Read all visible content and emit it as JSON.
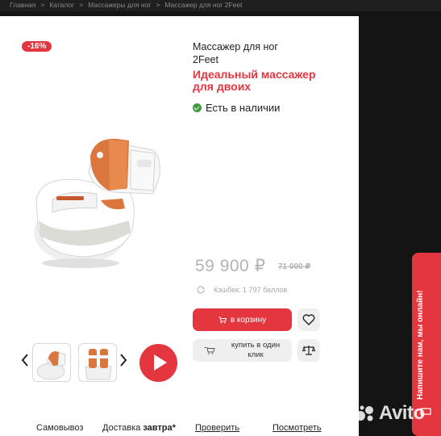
{
  "breadcrumb": [
    "Главная",
    "Каталог",
    "Массажеры для ног",
    "Массажер для ног 2Feet"
  ],
  "breadcrumb_separator": ">",
  "product": {
    "discount": "-16%",
    "title_line1": "Массажер для ног",
    "title_line2": "2Feet",
    "slogan_line1": "Идеальный массажер",
    "slogan_line2": "для двоих",
    "stock": "Есть в наличии",
    "price": "59 900 ₽",
    "old_price": "71 000 ₽",
    "cashback": "Кэшбек: 1 797 баллов"
  },
  "actions": {
    "cart": "в корзину",
    "one_click_line1": "купить в один",
    "one_click_line2": "клик"
  },
  "bottom": {
    "pickup": "Самовывоз",
    "delivery_prefix": "Доставка",
    "delivery_bold": "завтра*",
    "check": "Проверить",
    "view": "Посмотреть"
  },
  "chat": "Напишите нам, мы онлайн!",
  "watermark": "Avito",
  "colors": {
    "accent": "#e4363f",
    "stock": "#3c9b3a",
    "muted": "#b3b3b3"
  }
}
